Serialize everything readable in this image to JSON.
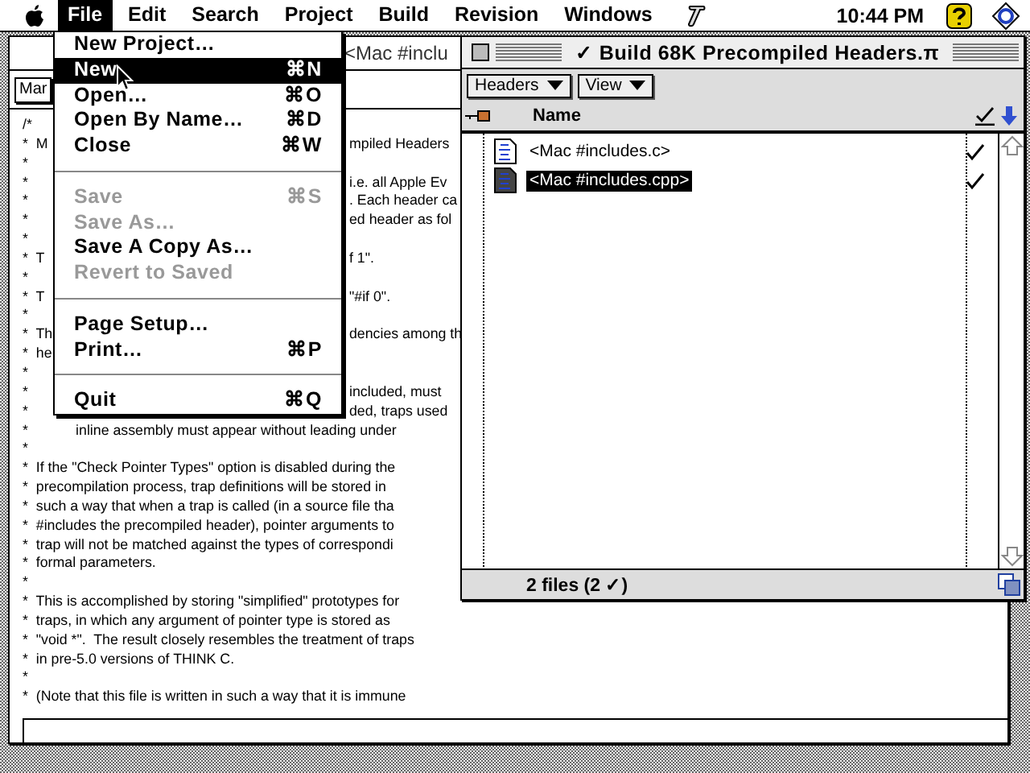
{
  "menu_bar": {
    "items": [
      {
        "label": "File",
        "selected": true
      },
      {
        "label": "Edit",
        "selected": false
      },
      {
        "label": "Search",
        "selected": false
      },
      {
        "label": "Project",
        "selected": false
      },
      {
        "label": "Build",
        "selected": false
      },
      {
        "label": "Revision",
        "selected": false
      },
      {
        "label": "Windows",
        "selected": false
      }
    ],
    "clock": "10:44 PM"
  },
  "file_menu": {
    "items": [
      {
        "kind": "item",
        "label": "New Project…",
        "disabled": false,
        "selected": false
      },
      {
        "kind": "item",
        "label": "New",
        "shortcut": "⌘N",
        "disabled": false,
        "selected": true
      },
      {
        "kind": "item",
        "label": "Open…",
        "shortcut": "⌘O",
        "disabled": false,
        "selected": false
      },
      {
        "kind": "item",
        "label": "Open By Name…",
        "shortcut": "⌘D",
        "disabled": false,
        "selected": false
      },
      {
        "kind": "item",
        "label": "Close",
        "shortcut": "⌘W",
        "disabled": false,
        "selected": false
      },
      {
        "kind": "separator"
      },
      {
        "kind": "item",
        "label": "Save",
        "shortcut": "⌘S",
        "disabled": true,
        "selected": false
      },
      {
        "kind": "item",
        "label": "Save As…",
        "disabled": true,
        "selected": false
      },
      {
        "kind": "item",
        "label": "Save A Copy As…",
        "disabled": false,
        "selected": false
      },
      {
        "kind": "item",
        "label": "Revert to Saved",
        "disabled": true,
        "selected": false
      },
      {
        "kind": "separator"
      },
      {
        "kind": "item",
        "label": "Page Setup…",
        "disabled": false,
        "selected": false
      },
      {
        "kind": "item",
        "label": "Print…",
        "shortcut": "⌘P",
        "disabled": false,
        "selected": false
      },
      {
        "kind": "separator"
      },
      {
        "kind": "item",
        "label": "Quit",
        "shortcut": "⌘Q",
        "disabled": false,
        "selected": false
      }
    ]
  },
  "editor": {
    "title": "<Mac #inclu",
    "popup": "Mar",
    "lines": [
      {
        "text": "/*"
      },
      {
        "text": "*  M",
        "tail": "mpiled Headers"
      },
      {
        "text": "*"
      },
      {
        "text": "*",
        "tail": "i.e. all Apple Ev"
      },
      {
        "text": "*",
        "tail": ". Each header ca"
      },
      {
        "text": "*",
        "tail": "ed header as fol"
      },
      {
        "text": "*"
      },
      {
        "text": "*  T",
        "tail": "f 1\"."
      },
      {
        "text": "*"
      },
      {
        "text": "*  T",
        "tail": "\"#if 0\"."
      },
      {
        "text": "*"
      },
      {
        "text": "*  Th",
        "tail": "dencies among th"
      },
      {
        "text": "*  he"
      },
      {
        "text": "*"
      },
      {
        "text": "*",
        "tail": "included, must"
      },
      {
        "text": "*",
        "tail": "ded, traps used"
      },
      {
        "text": "*            inline assembly must appear without leading under"
      },
      {
        "text": "*"
      },
      {
        "text": "*  If the \"Check Pointer Types\" option is disabled during the"
      },
      {
        "text": "*  precompilation process, trap definitions will be stored in"
      },
      {
        "text": "*  such a way that when a trap is called (in a source file tha"
      },
      {
        "text": "*  #includes the precompiled header), pointer arguments to"
      },
      {
        "text": "*  trap will not be matched against the types of correspondi"
      },
      {
        "text": "*  formal parameters."
      },
      {
        "text": "*"
      },
      {
        "text": "*  This is accomplished by storing \"simplified\" prototypes for"
      },
      {
        "text": "*  traps, in which any argument of pointer type is stored as"
      },
      {
        "text": "*  \"void *\".  The result closely resembles the treatment of traps"
      },
      {
        "text": "*  in pre-5.0 versions of THINK C."
      },
      {
        "text": "*"
      },
      {
        "text": "*  (Note that this file is written in such a way that it is immune"
      }
    ]
  },
  "project_window": {
    "title": "✓ Build 68K Precompiled Headers.π",
    "buttons": [
      "Headers",
      "View"
    ],
    "column": "Name",
    "rows": [
      {
        "name": "<Mac #includes.c>",
        "checked": true,
        "selected": false
      },
      {
        "name": "<Mac #includes.cpp>",
        "checked": true,
        "selected": true
      }
    ],
    "footer": "2 files (2 ✓)"
  }
}
